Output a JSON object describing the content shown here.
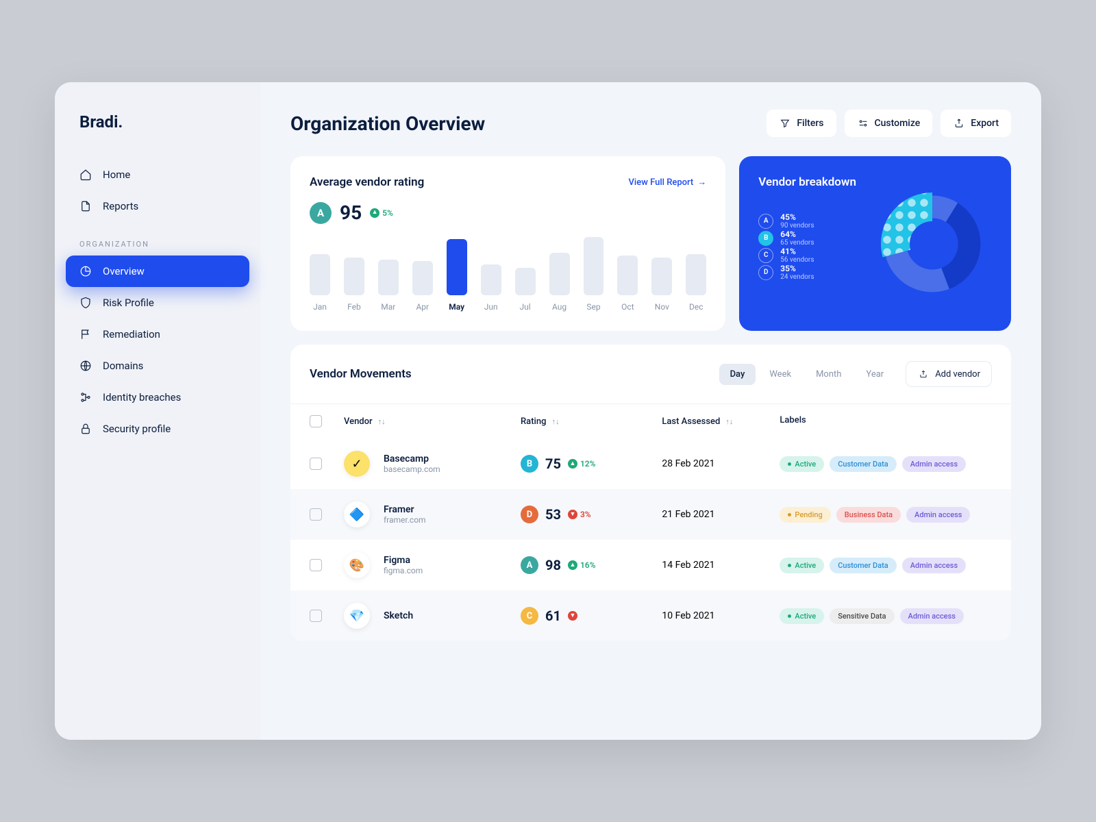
{
  "brand": "Bradi.",
  "nav": {
    "main": [
      {
        "label": "Home",
        "icon": "home"
      },
      {
        "label": "Reports",
        "icon": "document"
      }
    ],
    "section_label": "ORGANIZATION",
    "org": [
      {
        "label": "Overview",
        "icon": "pie",
        "active": true
      },
      {
        "label": "Risk Profile",
        "icon": "shield"
      },
      {
        "label": "Remediation",
        "icon": "flag"
      },
      {
        "label": "Domains",
        "icon": "globe"
      },
      {
        "label": "Identity breaches",
        "icon": "nodes"
      },
      {
        "label": "Security profile",
        "icon": "lock"
      }
    ]
  },
  "header": {
    "title": "Organization Overview",
    "actions": {
      "filters": "Filters",
      "customize": "Customize",
      "export": "Export"
    }
  },
  "rating_card": {
    "title": "Average vendor rating",
    "grade": "A",
    "value": "95",
    "delta": "5%",
    "link": "View Full Report"
  },
  "chart_data": {
    "type": "bar",
    "title": "Average vendor rating",
    "categories": [
      "Jan",
      "Feb",
      "Mar",
      "Apr",
      "May",
      "Jun",
      "Jul",
      "Aug",
      "Sep",
      "Oct",
      "Nov",
      "Dec"
    ],
    "values": [
      60,
      55,
      52,
      50,
      82,
      45,
      40,
      62,
      85,
      58,
      55,
      60
    ],
    "highlight_index": 4,
    "ylim": [
      0,
      100
    ]
  },
  "breakdown": {
    "title": "Vendor breakdown",
    "items": [
      {
        "grade": "A",
        "pct": "45%",
        "sub": "90 vendors"
      },
      {
        "grade": "B",
        "pct": "64%",
        "sub": "65 vendors",
        "highlight": true
      },
      {
        "grade": "C",
        "pct": "41%",
        "sub": "56 vendors"
      },
      {
        "grade": "D",
        "pct": "35%",
        "sub": "24 vendors"
      }
    ]
  },
  "movements": {
    "title": "Vendor Movements",
    "periods": [
      "Day",
      "Week",
      "Month",
      "Year"
    ],
    "active_period": "Day",
    "add_label": "Add vendor",
    "columns": {
      "vendor": "Vendor",
      "rating": "Rating",
      "date": "Last Assessed",
      "labels": "Labels"
    },
    "rows": [
      {
        "name": "Basecamp",
        "domain": "basecamp.com",
        "logo_bg": "#FCE16A",
        "logo_text": "✓",
        "grade": "B",
        "grade_class": "grade-B",
        "rating": "75",
        "delta": "12%",
        "dir": "up",
        "date": "28 Feb 2021",
        "labels": [
          {
            "t": "Active",
            "c": "pill-active",
            "dot": true
          },
          {
            "t": "Customer Data",
            "c": "pill-customer"
          },
          {
            "t": "Admin access",
            "c": "pill-admin"
          }
        ]
      },
      {
        "name": "Framer",
        "domain": "framer.com",
        "logo_bg": "#fff",
        "logo_text": "🔷",
        "grade": "D",
        "grade_class": "grade-D",
        "rating": "53",
        "delta": "3%",
        "dir": "down",
        "date": "21 Feb 2021",
        "alt": true,
        "labels": [
          {
            "t": "Pending",
            "c": "pill-pending",
            "dot": true
          },
          {
            "t": "Business Data",
            "c": "pill-business"
          },
          {
            "t": "Admin access",
            "c": "pill-admin"
          }
        ]
      },
      {
        "name": "Figma",
        "domain": "figma.com",
        "logo_bg": "#fff",
        "logo_text": "🎨",
        "grade": "A",
        "grade_class": "grade-A",
        "rating": "98",
        "delta": "16%",
        "dir": "up",
        "date": "14 Feb 2021",
        "labels": [
          {
            "t": "Active",
            "c": "pill-active",
            "dot": true
          },
          {
            "t": "Customer Data",
            "c": "pill-customer"
          },
          {
            "t": "Admin access",
            "c": "pill-admin"
          }
        ]
      },
      {
        "name": "Sketch",
        "domain": "",
        "logo_bg": "#fff",
        "logo_text": "💎",
        "grade": "C",
        "grade_class": "grade-C",
        "rating": "61",
        "delta": "",
        "dir": "down",
        "date": "10 Feb 2021",
        "alt": true,
        "labels": [
          {
            "t": "Active",
            "c": "pill-active",
            "dot": true
          },
          {
            "t": "Sensitive Data",
            "c": "pill-sensitive"
          },
          {
            "t": "Admin access",
            "c": "pill-admin"
          }
        ]
      }
    ]
  }
}
